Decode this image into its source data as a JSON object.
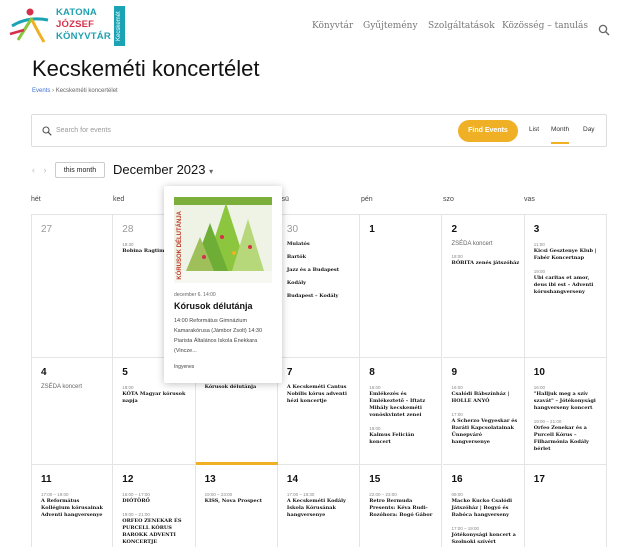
{
  "header": {
    "logo": {
      "line1": "KATONA",
      "line2": "JÓZSEF",
      "line3": "KÖNYVTÁR",
      "side": "Kecskemét"
    },
    "nav": [
      "Könyvtár",
      "Gyűjtemény",
      "Szolgáltatások",
      "Közösség – tanulás"
    ]
  },
  "page": {
    "title": "Kecskeméti koncertélet",
    "breadcrumb": {
      "root": "Events",
      "sep": " › ",
      "current": "Kecskeméti koncertélet"
    }
  },
  "filter": {
    "search_placeholder": "Search for events",
    "find_label": "Find Events",
    "views": [
      "List",
      "Month",
      "Day"
    ],
    "active_view": "Month"
  },
  "toolbar": {
    "prev": "‹",
    "next": "›",
    "this_month": "this month",
    "month_label": "December 2023"
  },
  "weekdays": [
    "hét",
    "ked",
    "sze",
    "csü",
    "pén",
    "szo",
    "vas"
  ],
  "weeks": [
    [
      {
        "num": "27",
        "gray": true,
        "events": []
      },
      {
        "num": "28",
        "gray": true,
        "events": [
          {
            "time": "19:30",
            "name": "Bobina Ragtime Band"
          }
        ]
      },
      {
        "num": "29",
        "gray": true,
        "events": []
      },
      {
        "num": "30",
        "gray": true,
        "events": [
          {
            "time": "",
            "name": "Mulatós"
          },
          {
            "time": "",
            "name": "Bartók"
          },
          {
            "time": "",
            "name": "Jazz és a Budapest"
          },
          {
            "time": "",
            "name": "Kodály"
          },
          {
            "time": "",
            "name": "Budapest – Kodály"
          }
        ]
      },
      {
        "num": "1",
        "gray": false,
        "events": []
      },
      {
        "num": "2",
        "gray": false,
        "allday": "ZSÉDA koncert",
        "events": [
          {
            "time": "18:00",
            "name": "BÓBITA zenés játszóház"
          }
        ]
      },
      {
        "num": "3",
        "gray": false,
        "events": [
          {
            "time": "11:00",
            "name": "Kicsi Gesztenye Klub | Fabér Koncertnap"
          },
          {
            "time": "19:00",
            "name": "Ubi caritas et amor, deus ibi est – Adventi kórushangverseny"
          }
        ]
      }
    ],
    [
      {
        "num": "4",
        "gray": false,
        "allday": "ZSÉDA koncert",
        "events": []
      },
      {
        "num": "5",
        "gray": false,
        "events": [
          {
            "time": "18:00",
            "name": "KÓTA Magyar kórusok napja"
          }
        ]
      },
      {
        "num": "6",
        "gray": false,
        "events": [
          {
            "time": "",
            "name": "Kórusok délutánja"
          }
        ]
      },
      {
        "num": "7",
        "gray": false,
        "events": [
          {
            "time": "",
            "name": "A Kecskeméti Cantus Nobilis kórus adventi hézi koncertje"
          }
        ]
      },
      {
        "num": "8",
        "gray": false,
        "events": [
          {
            "time": "16:00",
            "name": "Emlékezés és Emlékeztető – Iftatz Mihály kecskeméti vonóskvintet zenei"
          },
          {
            "time": "19:00",
            "name": "Kalmus Felicián koncert"
          }
        ]
      },
      {
        "num": "9",
        "gray": false,
        "events": [
          {
            "time": "16:00",
            "name": "Csalódi Bábszínház | HOLLE ANYÓ"
          },
          {
            "time": "17:00",
            "name": "A Scherzo Vegyeskar és Baráti Kapcsolatainak Ünnepváró hangversenye"
          }
        ]
      },
      {
        "num": "10",
        "gray": false,
        "events": [
          {
            "time": "16:00",
            "name": "\"Halljuk meg a szív szavát\" – Jótékonysági hangverseny koncert"
          },
          {
            "time": "19:00 – 21:00",
            "name": "Orfeo Zenekar és a Purcell Kórus – Filharmónia Kodály bérlet"
          }
        ]
      }
    ],
    [
      {
        "num": "11",
        "gray": false,
        "events": [
          {
            "time": "17:00 – 19:00",
            "name": "A Református Kollégium kórusainak Adventi hangversenye"
          }
        ]
      },
      {
        "num": "12",
        "gray": false,
        "events": [
          {
            "time": "16:00 – 17:00",
            "name": "DIÓTÖRŐ"
          },
          {
            "time": "19:00 – 21:00",
            "name": "ORFEO ZENEKAR ÉS PURCELL KÓRUS BAROKK ADVENTI KONCERTJE"
          }
        ]
      },
      {
        "num": "13",
        "gray": false,
        "events": [
          {
            "time": "19:00 – 23:00",
            "name": "KISS, Nova Prospect"
          }
        ]
      },
      {
        "num": "14",
        "gray": false,
        "events": [
          {
            "time": "17:00 – 18:30",
            "name": "A Kecskeméti Kodály Iskola Kórusának hangversenye"
          }
        ]
      },
      {
        "num": "15",
        "gray": false,
        "events": [
          {
            "time": "22:00 – 23:00",
            "name": "Retro Bermuda Presents: Kéva Rudi-Rozóhora: Bogó Gábor"
          }
        ]
      },
      {
        "num": "16",
        "gray": false,
        "events": [
          {
            "time": "09:00",
            "name": "Macko Kucko Csalódi Játszóház | Bogyó és Babóca hangverseny"
          },
          {
            "time": "17:00 – 19:00",
            "name": "Jótékonysági koncert a Szolnoki szívért"
          }
        ]
      },
      {
        "num": "17",
        "gray": false,
        "events": []
      }
    ]
  ],
  "popup": {
    "poster_title": "KÓRUSOK DÉLUTÁNJA",
    "time": "december 6. 14:00",
    "title": "Kórusok délutánja",
    "description": "14:00 Református Gimnázium Kamarakórusa (Jámbor Zsolt) 14:30 Piarista Általános Iskola Énekkara (Vincze...",
    "more": "Ingyenes"
  },
  "colors": {
    "accent": "#f0b025",
    "link": "#3b6fd1",
    "brand_teal": "#1aa3b5",
    "brand_red": "#d6314a"
  }
}
